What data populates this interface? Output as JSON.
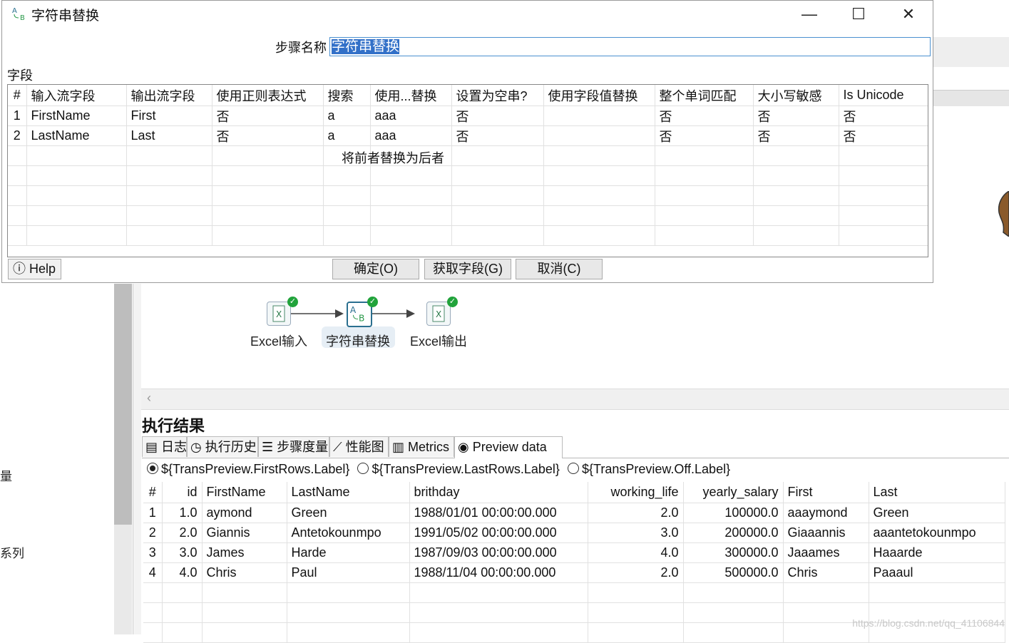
{
  "dialog": {
    "title": "字符串替换",
    "minimize": "—",
    "maximize": "☐",
    "close": "✕",
    "step_name_label": "步骤名称",
    "step_name_value": "字符串替换",
    "fields_label": "字段",
    "columns": [
      "#",
      "输入流字段",
      "输出流字段",
      "使用正则表达式",
      "搜索",
      "使用...替换",
      "设置为空串?",
      "使用字段值替换",
      "整个单词匹配",
      "大小写敏感",
      "Is Unicode"
    ],
    "rows": [
      [
        "1",
        "FirstName",
        "First",
        "否",
        "a",
        "aaa",
        "否",
        "",
        "否",
        "否",
        "否"
      ],
      [
        "2",
        "LastName",
        "Last",
        "否",
        "a",
        "aaa",
        "否",
        "",
        "否",
        "否",
        "否"
      ]
    ],
    "tooltip": "将前者替换为后者",
    "buttons": {
      "help": "Help",
      "ok": "确定(O)",
      "get_fields": "获取字段(G)",
      "cancel": "取消(C)"
    }
  },
  "background": {
    "left_text_1": "量",
    "left_text_2": "系列"
  },
  "flow": {
    "steps": [
      {
        "label": "Excel输入"
      },
      {
        "label": "字符串替换"
      },
      {
        "label": "Excel输出"
      }
    ]
  },
  "results": {
    "title": "执行结果",
    "tabs": [
      "日志",
      "执行历史",
      "步骤度量",
      "性能图",
      "Metrics",
      "Preview data"
    ],
    "active_tab": "Preview data",
    "radios": [
      {
        "label": "${TransPreview.FirstRows.Label}",
        "selected": true
      },
      {
        "label": "${TransPreview.LastRows.Label}",
        "selected": false
      },
      {
        "label": "${TransPreview.Off.Label}",
        "selected": false
      }
    ],
    "columns": [
      "#",
      "id",
      "FirstName",
      "LastName",
      "brithday",
      "working_life",
      "yearly_salary",
      "First",
      "Last"
    ],
    "rows": [
      [
        "1",
        "1.0",
        "aymond",
        "Green",
        "1988/01/01 00:00:00.000",
        "2.0",
        "100000.0",
        "aaaymond",
        "Green"
      ],
      [
        "2",
        "2.0",
        "Giannis",
        "Antetokounmpo",
        "1991/05/02 00:00:00.000",
        "3.0",
        "200000.0",
        "Giaaannis",
        "aaantetokounmpo"
      ],
      [
        "3",
        "3.0",
        "James",
        "Harde",
        "1987/09/03 00:00:00.000",
        "4.0",
        "300000.0",
        "Jaaames",
        "Haaarde"
      ],
      [
        "4",
        "4.0",
        "Chris",
        "Paul",
        "1988/11/04 00:00:00.000",
        "2.0",
        "500000.0",
        "Chris",
        "Paaaul"
      ]
    ]
  },
  "watermark": "https://blog.csdn.net/qq_41106844",
  "colors": {
    "selection": "#3270c8",
    "check": "#21a33b",
    "step_border": "#2a6f8f"
  }
}
